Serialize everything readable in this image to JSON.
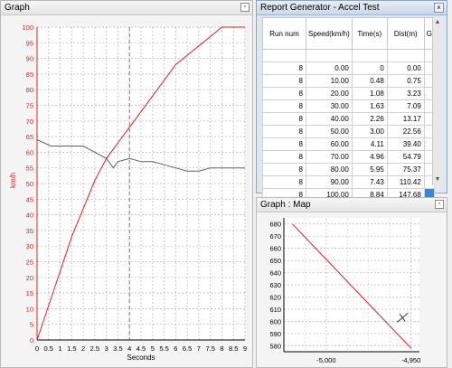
{
  "graph": {
    "title": "Graph",
    "x_axis": {
      "title": "Seconds",
      "min": 0,
      "max": 9,
      "ticks": [
        "0",
        "0.5",
        "1",
        "1.5",
        "2",
        "2.5",
        "3",
        "3.5",
        "4",
        "4.5",
        "5",
        "5.5",
        "6",
        "6.5",
        "7",
        "7.5",
        "8",
        "8.5",
        "9"
      ]
    },
    "y_axis": {
      "title": "km/h",
      "min": 0,
      "max": 100,
      "ticks": [
        "0",
        "5",
        "10",
        "15",
        "20",
        "25",
        "30",
        "35",
        "40",
        "45",
        "50",
        "55",
        "60",
        "65",
        "70",
        "75",
        "80",
        "85",
        "90",
        "95",
        "100"
      ]
    },
    "cursor_x": 4.0
  },
  "chart_data": [
    {
      "type": "line",
      "series": [
        {
          "name": "",
          "color": "#e02020",
          "x": [
            0,
            0.5,
            1,
            1.5,
            2,
            2.5,
            3,
            3.5,
            4,
            4.5,
            5,
            5.5,
            6,
            6.5,
            7,
            7.5,
            8,
            8.5,
            9
          ],
          "y": [
            0,
            11,
            22,
            33,
            42,
            51,
            58,
            63,
            68,
            73,
            78,
            83,
            88,
            91,
            94,
            97,
            100,
            103,
            106
          ]
        },
        {
          "name": "",
          "color": "#606060",
          "x": [
            0,
            0.3,
            0.6,
            1,
            1.5,
            2,
            2.5,
            3,
            3.3,
            3.5,
            4,
            4.5,
            5,
            5.5,
            6,
            6.5,
            7,
            7.5,
            8,
            8.5,
            9
          ],
          "y": [
            64,
            63,
            62,
            62,
            62,
            62,
            60,
            58,
            55,
            57,
            58,
            57,
            57,
            56,
            55,
            54,
            54,
            55,
            55,
            55,
            55
          ]
        }
      ],
      "xlim": [
        0,
        9
      ],
      "ylim": [
        0,
        100
      ],
      "grid": true
    },
    {
      "type": "line",
      "series": [
        {
          "name": "",
          "color": "#e02020",
          "x": [
            -5020,
            -4950
          ],
          "y": [
            680,
            578
          ]
        }
      ],
      "xlim": [
        -5025,
        -4945
      ],
      "ylim": [
        575,
        685
      ],
      "grid": true
    }
  ],
  "report": {
    "title": "Report Generator - Accel Test",
    "close_label": "×",
    "columns": [
      "Run num",
      "Speed(km/h)",
      "Time(s)",
      "Dist(m)",
      "G"
    ],
    "rows": [
      [
        "8",
        "0.00",
        "0",
        "0.00"
      ],
      [
        "8",
        "10.00",
        "0.48",
        "0.75"
      ],
      [
        "8",
        "20.00",
        "1.08",
        "3.23"
      ],
      [
        "8",
        "30.00",
        "1.63",
        "7.09"
      ],
      [
        "8",
        "40.00",
        "2.26",
        "13.17"
      ],
      [
        "8",
        "50.00",
        "3.00",
        "22.56"
      ],
      [
        "8",
        "60.00",
        "4.11",
        "39.40"
      ],
      [
        "8",
        "70.00",
        "4.96",
        "54.79"
      ],
      [
        "8",
        "80.00",
        "5.95",
        "75.37"
      ],
      [
        "8",
        "90.00",
        "7.43",
        "110.42"
      ],
      [
        "8",
        "100.00",
        "8.84",
        "147.68"
      ]
    ]
  },
  "map": {
    "title": "Graph : Map",
    "y_ticks": [
      "580",
      "590",
      "600",
      "610",
      "620",
      "630",
      "640",
      "650",
      "660",
      "670",
      "680"
    ],
    "x_ticks": [
      "-5,000",
      "-4,950"
    ],
    "marker": {
      "x": -4955,
      "y": 603
    }
  }
}
